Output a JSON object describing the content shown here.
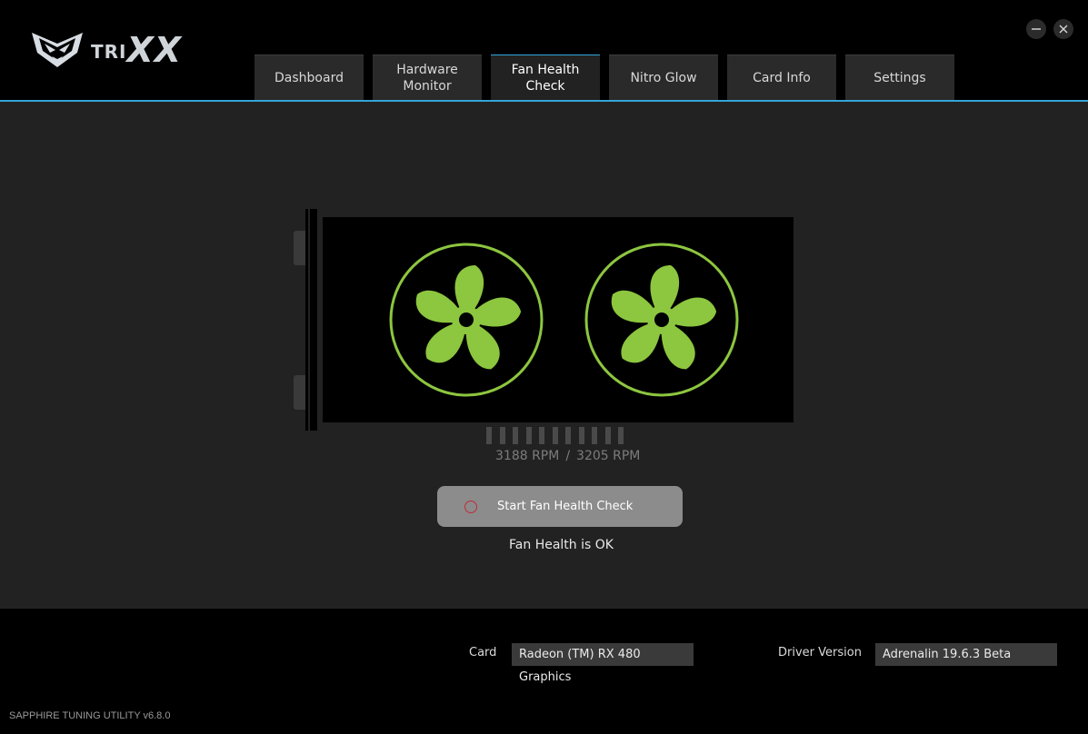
{
  "app": {
    "logo_text_small": "TRI",
    "logo_text_large": "XX",
    "window_controls": {
      "minimize_icon": "minimize-icon",
      "close_icon": "close-icon"
    }
  },
  "tabs": [
    {
      "label": "Dashboard",
      "active": false
    },
    {
      "label": "Hardware\nMonitor",
      "active": false
    },
    {
      "label": "Fan Health\nCheck",
      "active": true
    },
    {
      "label": "Nitro Glow",
      "active": false
    },
    {
      "label": "Card Info",
      "active": false
    },
    {
      "label": "Settings",
      "active": false
    }
  ],
  "fan_check": {
    "fan1_rpm": "3188 RPM",
    "separator": "/",
    "fan2_rpm": "3205 RPM",
    "start_button_label": "Start Fan Health Check",
    "status_text": "Fan Health is OK",
    "fan_color": "#8dc63f"
  },
  "footer": {
    "card_label": "Card",
    "card_value": "Radeon (TM) RX 480 Graphics",
    "driver_label": "Driver Version",
    "driver_value": "Adrenalin 19.6.3 Beta",
    "version": "SAPPHIRE TUNING UTILITY v6.8.0"
  },
  "colors": {
    "accent": "#35a4d8",
    "background": "#222222",
    "header": "#000000"
  }
}
